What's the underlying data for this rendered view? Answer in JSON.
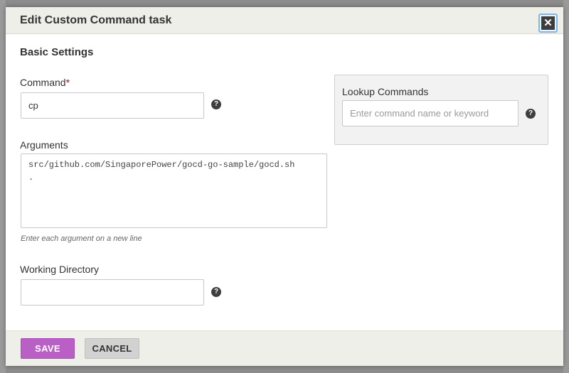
{
  "modal": {
    "title": "Edit Custom Command task",
    "close_glyph": "✕"
  },
  "basic_settings": {
    "heading": "Basic Settings",
    "command": {
      "label": "Command",
      "required_mark": "*",
      "value": "cp"
    },
    "arguments": {
      "label": "Arguments",
      "value": "src/github.com/SingaporePower/gocd-go-sample/gocd.sh\n.",
      "help": "Enter each argument on a new line"
    },
    "working_directory": {
      "label": "Working Directory",
      "value": ""
    },
    "help_glyph": "?"
  },
  "lookup": {
    "label": "Lookup Commands",
    "placeholder": "Enter command name or keyword"
  },
  "footer": {
    "save_label": "SAVE",
    "cancel_label": "CANCEL"
  },
  "colors": {
    "save_button": "#b95fc6",
    "required_mark": "#b40f1e",
    "header_background": "#efefe9"
  }
}
